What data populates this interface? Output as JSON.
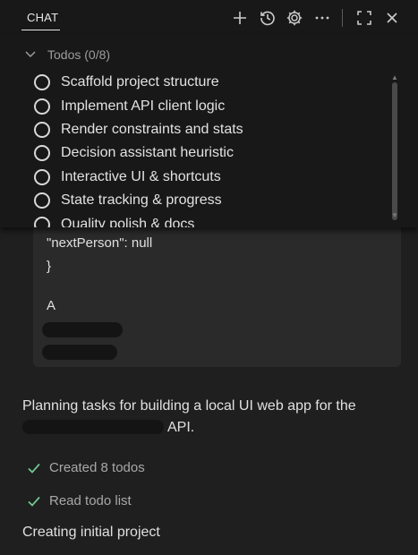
{
  "header": {
    "title": "CHAT",
    "icons": [
      "plus-icon",
      "history-icon",
      "gear-icon",
      "ellipsis-icon",
      "maximize-icon",
      "close-icon"
    ]
  },
  "todos": {
    "header": "Todos (0/8)",
    "items": [
      "Scaffold project structure",
      "Implement API client logic",
      "Render constraints and stats",
      "Decision assistant heuristic",
      "Interactive UI & shortcuts",
      "State tracking & progress",
      "Quality polish & docs"
    ]
  },
  "code": {
    "line_next": "\"nextPerson\": null",
    "line_brace": "}",
    "line_a": "A"
  },
  "messages": {
    "planning_prefix": "Planning tasks for building a local UI web app for the",
    "planning_suffix": "API."
  },
  "steps": [
    {
      "label": "Created 8 todos"
    },
    {
      "label": "Read todo list"
    }
  ],
  "status": "Creating initial project",
  "colors": {
    "background": "#1f1f1f",
    "panel": "#181818",
    "card": "#2a2a2a",
    "check": "#73c991"
  }
}
